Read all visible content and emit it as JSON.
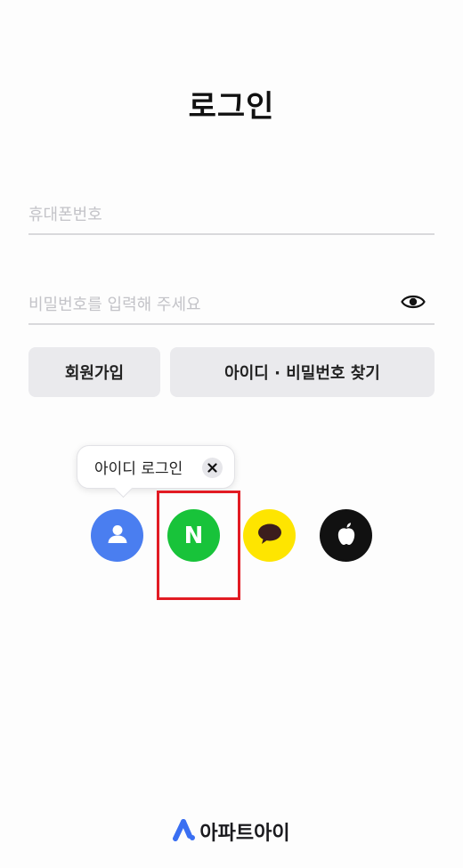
{
  "page": {
    "title": "로그인"
  },
  "phone": {
    "placeholder": "휴대폰번호",
    "value": ""
  },
  "password": {
    "placeholder": "비밀번호를 입력해 주세요",
    "value": "",
    "toggle_icon": "eye-icon"
  },
  "actions": {
    "signup_label": "회원가입",
    "find_label": "아이디 · 비밀번호 찾기"
  },
  "tooltip": {
    "text": "아이디 로그인",
    "close_icon": "close-icon"
  },
  "social": [
    {
      "name": "id-login",
      "icon": "person-icon",
      "color": "#4a7ef0"
    },
    {
      "name": "naver-login",
      "icon": "naver-n-icon",
      "color": "#18c33a",
      "glyph": "N"
    },
    {
      "name": "kakao-login",
      "icon": "speech-bubble-icon",
      "color": "#fee500"
    },
    {
      "name": "apple-login",
      "icon": "apple-icon",
      "color": "#111111"
    }
  ],
  "highlight": {
    "color": "#e21b23"
  },
  "brand": {
    "name": "아파트아이",
    "logo_icon": "apartmentai-logo-icon",
    "accent": "#3a6ff2"
  }
}
